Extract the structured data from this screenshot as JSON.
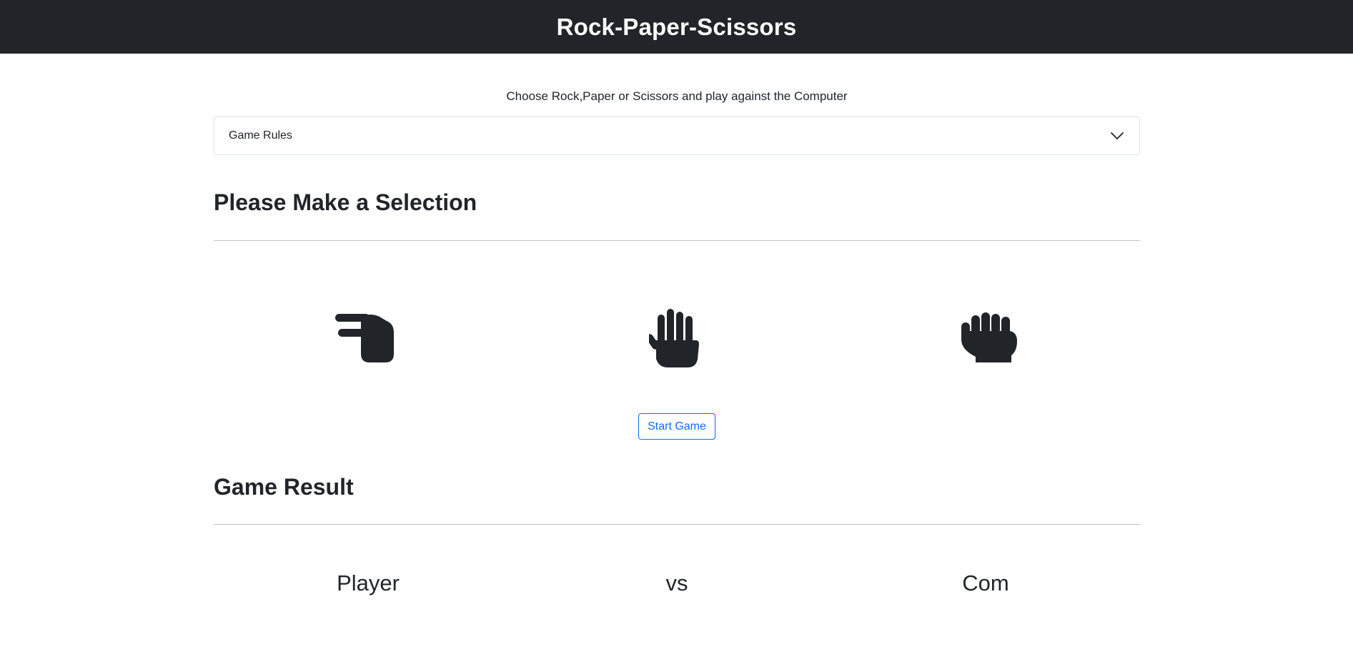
{
  "navbar": {
    "title": "Rock-Paper-Scissors"
  },
  "intro": {
    "text": "Choose Rock,Paper or Scissors and play against the Computer"
  },
  "accordion": {
    "label": "Game Rules",
    "icon": "chevron-down-icon"
  },
  "selection": {
    "heading": "Please Make a Selection",
    "choices": [
      {
        "icon": "hand-scissors-icon"
      },
      {
        "icon": "hand-paper-icon"
      },
      {
        "icon": "hand-rock-icon"
      }
    ],
    "start_label": "Start Game"
  },
  "result": {
    "heading": "Game Result",
    "player_label": "Player",
    "vs_label": "vs",
    "com_label": "Com"
  },
  "colors": {
    "navbar_bg": "#212529",
    "accent": "#0d6efd",
    "text": "#212529"
  }
}
